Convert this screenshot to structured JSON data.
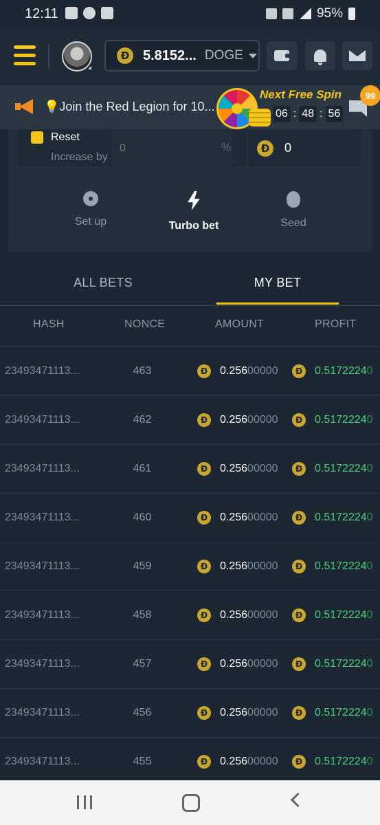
{
  "status_bar": {
    "time": "12:11",
    "battery": "95%"
  },
  "header": {
    "balance": "5.8152...",
    "currency": "DOGE",
    "coin_symbol": "Ð"
  },
  "announcement": {
    "text": "💡Join the Red Legion for 10...",
    "spin_title": "Next Free Spin",
    "timer": [
      "06",
      "48",
      "56"
    ],
    "badge_count": "99"
  },
  "settings_panel": {
    "reset_label": "Reset",
    "increase_label": "Increase by",
    "increase_placeholder": "0",
    "percent_symbol": "%",
    "right_value": "0",
    "tabs": [
      {
        "label": "Set up",
        "icon": "gear-icon"
      },
      {
        "label": "Turbo bet",
        "icon": "lightning-icon",
        "active": true
      },
      {
        "label": "Seed",
        "icon": "acorn-icon"
      }
    ]
  },
  "bet_tabs": {
    "all_bets": "ALL BETS",
    "my_bet": "MY BET",
    "active": "MY BET"
  },
  "table": {
    "headers": [
      "HASH",
      "NONCE",
      "AMOUNT",
      "PROFIT"
    ],
    "rows": [
      {
        "hash": "23493471113...",
        "nonce": "463",
        "amount_hi": "0.256",
        "amount_lo": "00000",
        "profit_hi": "0.5172224",
        "profit_lo": "0"
      },
      {
        "hash": "23493471113...",
        "nonce": "462",
        "amount_hi": "0.256",
        "amount_lo": "00000",
        "profit_hi": "0.5172224",
        "profit_lo": "0"
      },
      {
        "hash": "23493471113...",
        "nonce": "461",
        "amount_hi": "0.256",
        "amount_lo": "00000",
        "profit_hi": "0.5172224",
        "profit_lo": "0"
      },
      {
        "hash": "23493471113...",
        "nonce": "460",
        "amount_hi": "0.256",
        "amount_lo": "00000",
        "profit_hi": "0.5172224",
        "profit_lo": "0"
      },
      {
        "hash": "23493471113...",
        "nonce": "459",
        "amount_hi": "0.256",
        "amount_lo": "00000",
        "profit_hi": "0.5172224",
        "profit_lo": "0"
      },
      {
        "hash": "23493471113...",
        "nonce": "458",
        "amount_hi": "0.256",
        "amount_lo": "00000",
        "profit_hi": "0.5172224",
        "profit_lo": "0"
      },
      {
        "hash": "23493471113...",
        "nonce": "457",
        "amount_hi": "0.256",
        "amount_lo": "00000",
        "profit_hi": "0.5172224",
        "profit_lo": "0"
      },
      {
        "hash": "23493471113...",
        "nonce": "456",
        "amount_hi": "0.256",
        "amount_lo": "00000",
        "profit_hi": "0.5172224",
        "profit_lo": "0"
      },
      {
        "hash": "23493471113...",
        "nonce": "455",
        "amount_hi": "0.256",
        "amount_lo": "00000",
        "profit_hi": "0.5172224",
        "profit_lo": "0"
      }
    ]
  },
  "colors": {
    "background": "#1c2733",
    "accent": "#f5c518",
    "profit": "#4cd07a",
    "coin": "#c8a630"
  }
}
